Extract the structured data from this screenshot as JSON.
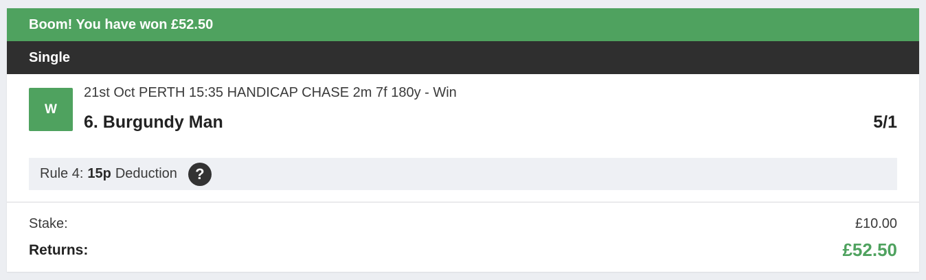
{
  "banner": {
    "text": "Boom! You have won £52.50",
    "color": "#4fa25f"
  },
  "bet": {
    "type": "Single"
  },
  "selection": {
    "result_badge": "W",
    "event": "21st Oct PERTH 15:35 HANDICAP CHASE 2m 7f 180y - Win",
    "runner": "6. Burgundy Man",
    "odds": "5/1"
  },
  "rule4": {
    "prefix": "Rule 4:",
    "amount": "15p",
    "suffix": "Deduction",
    "help_icon": "question-mark-icon",
    "help_glyph": "?"
  },
  "summary": {
    "stake_label": "Stake:",
    "stake_value": "£10.00",
    "returns_label": "Returns:",
    "returns_value": "£52.50"
  },
  "colors": {
    "accent_green": "#4fa25f",
    "header_dark": "#2f2f2f"
  }
}
